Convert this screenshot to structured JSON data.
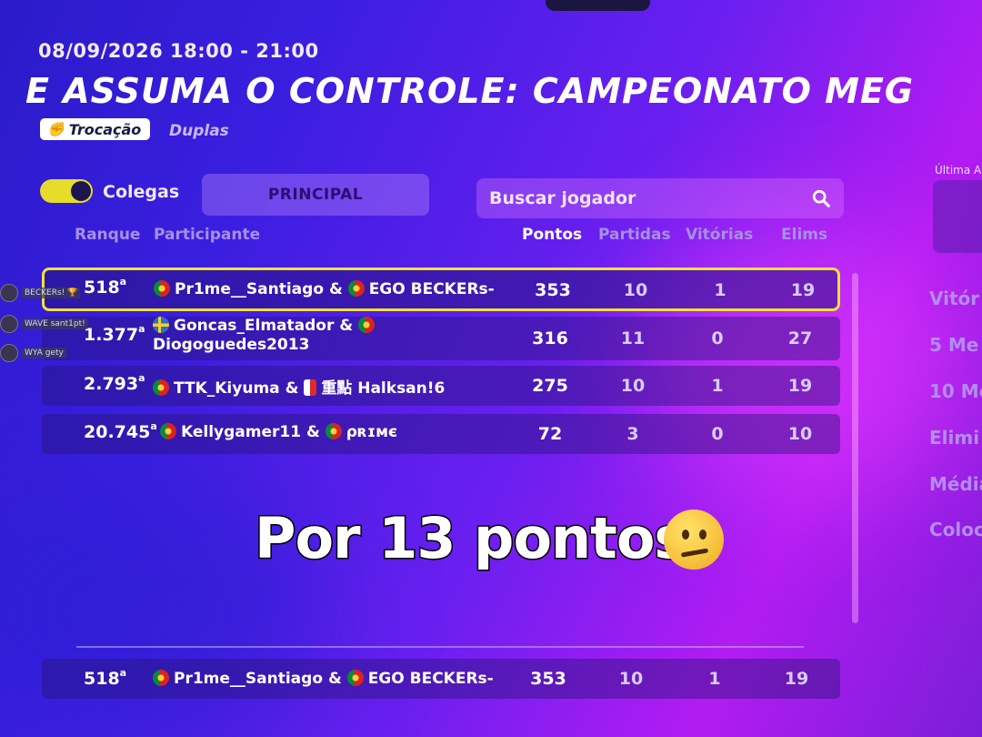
{
  "header": {
    "date_time": "08/09/2026 18:00 - 21:00",
    "title": "E ASSUMA O CONTROLE: CAMPEONATO MEG",
    "mode_badge": "Trocação",
    "mode_sub": "Duplas"
  },
  "controls": {
    "toggle_label": "Colegas",
    "toggle_on": true,
    "tab_principal": "PRINCIPAL",
    "search_placeholder": "Buscar jogador"
  },
  "columns": {
    "rank": "Ranque",
    "participant": "Participante",
    "points": "Pontos",
    "matches": "Partidas",
    "wins": "Vitórias",
    "elims": "Elims"
  },
  "rows": [
    {
      "rank": "518",
      "rank_suffix": "a",
      "p1": "Pr1me__Santiago",
      "p1_flag": "pt",
      "sep": "&",
      "p2": "EGO BECKERs-",
      "p2_flag": "pt",
      "points": "353",
      "matches": "10",
      "wins": "1",
      "elims": "19",
      "highlighted": true
    },
    {
      "rank": "1.377",
      "rank_suffix": "a",
      "p1": "Goncas_Elmatador",
      "p1_flag": "se",
      "sep": "&",
      "p2": "Diogoguedes2013",
      "p2_flag": "pt",
      "points": "316",
      "matches": "11",
      "wins": "0",
      "elims": "27",
      "highlighted": false
    },
    {
      "rank": "2.793",
      "rank_suffix": "a",
      "p1": "TTK_Kiyuma",
      "p1_flag": "pt",
      "sep": "&",
      "p2": "重點 Halksan!6",
      "p2_flag": "fr",
      "points": "275",
      "matches": "10",
      "wins": "1",
      "elims": "19",
      "highlighted": false
    },
    {
      "rank": "20.745",
      "rank_suffix": "a",
      "p1": "Kellygamer11",
      "p1_flag": "pt",
      "sep": "&",
      "p2": "ρʀɪмє",
      "p2_flag": "pt",
      "points": "72",
      "matches": "3",
      "wins": "0",
      "elims": "10",
      "highlighted": false
    }
  ],
  "self_row": {
    "rank": "518",
    "rank_suffix": "a",
    "p1": "Pr1me__Santiago",
    "sep": "&",
    "p2": "EGO BECKERs-",
    "points": "353",
    "matches": "10",
    "wins": "1",
    "elims": "19"
  },
  "caption": "Por 13 pontos",
  "side_panel": {
    "label": "Última A",
    "items": [
      "Vitór",
      "5 Me",
      "10 Me",
      "Elimi",
      "Média",
      "Coloc"
    ]
  },
  "party": [
    {
      "name": "BECKERs! 🏆"
    },
    {
      "name": "WAVE sant1pt!"
    },
    {
      "name": "WYA gety"
    }
  ]
}
